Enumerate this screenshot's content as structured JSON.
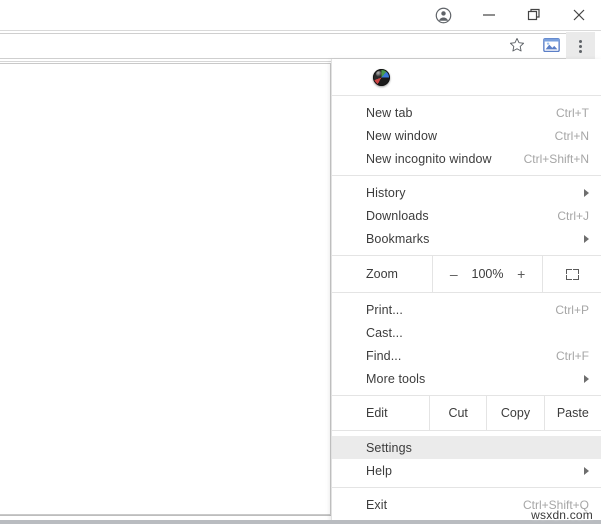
{
  "window": {
    "controls": [
      {
        "name": "profile-button",
        "icon": "account-circle-icon",
        "label": ""
      },
      {
        "name": "minimize-button",
        "icon": "minimize-icon",
        "label": ""
      },
      {
        "name": "maximize-button",
        "icon": "restore-icon",
        "label": ""
      },
      {
        "name": "close-button",
        "icon": "close-icon",
        "label": ""
      }
    ]
  },
  "toolbar": {
    "address_value": "",
    "address_placeholder": "",
    "star_icon": "star-icon",
    "extension_icon": "extension-icon",
    "menu_icon": "three-dot-menu-icon"
  },
  "menu": {
    "avatar_icon": "profile-avatar-icon",
    "groups": [
      {
        "items": [
          {
            "label": "New tab",
            "accel": "Ctrl+T",
            "submenu": false,
            "selected": false
          },
          {
            "label": "New window",
            "accel": "Ctrl+N",
            "submenu": false,
            "selected": false
          },
          {
            "label": "New incognito window",
            "accel": "Ctrl+Shift+N",
            "submenu": false,
            "selected": false
          }
        ]
      },
      {
        "items": [
          {
            "label": "History",
            "accel": "",
            "submenu": true,
            "selected": false
          },
          {
            "label": "Downloads",
            "accel": "Ctrl+J",
            "submenu": false,
            "selected": false
          },
          {
            "label": "Bookmarks",
            "accel": "",
            "submenu": true,
            "selected": false
          }
        ]
      }
    ],
    "zoom": {
      "label": "Zoom",
      "minus": "–",
      "level": "100%",
      "plus": "+",
      "fullscreen_icon": "fullscreen-icon"
    },
    "group3": {
      "items": [
        {
          "label": "Print...",
          "accel": "Ctrl+P",
          "submenu": false,
          "selected": false
        },
        {
          "label": "Cast...",
          "accel": "",
          "submenu": false,
          "selected": false
        },
        {
          "label": "Find...",
          "accel": "Ctrl+F",
          "submenu": false,
          "selected": false
        },
        {
          "label": "More tools",
          "accel": "",
          "submenu": true,
          "selected": false
        }
      ]
    },
    "edit_row": {
      "label": "Edit",
      "actions": [
        "Cut",
        "Copy",
        "Paste"
      ]
    },
    "group4": {
      "items": [
        {
          "label": "Settings",
          "accel": "",
          "submenu": false,
          "selected": true
        },
        {
          "label": "Help",
          "accel": "",
          "submenu": true,
          "selected": false
        }
      ]
    },
    "group5": {
      "items": [
        {
          "label": "Exit",
          "accel": "Ctrl+Shift+Q",
          "submenu": false,
          "selected": false
        }
      ]
    }
  },
  "watermark": {
    "text": "wsxdn.com"
  },
  "colors": {
    "menu_bg": "#ffffff",
    "selected_bg": "#ebebeb",
    "separator": "#e4e4e4",
    "text": "#3c3c3c",
    "accel_text": "#a6a6a6"
  }
}
